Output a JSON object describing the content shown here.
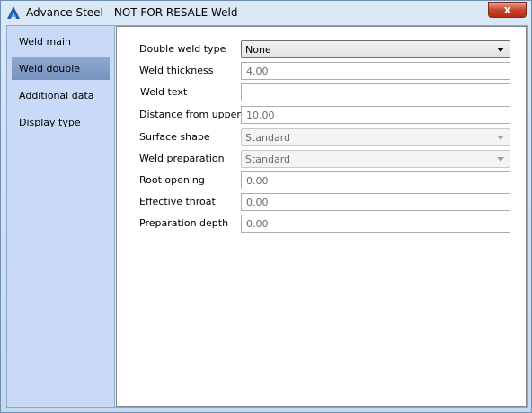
{
  "window": {
    "title": "Advance Steel - NOT FOR RESALE   Weld",
    "close_label": "x"
  },
  "sidebar": {
    "items": [
      {
        "label": "Weld main"
      },
      {
        "label": "Weld double"
      },
      {
        "label": "Additional data"
      },
      {
        "label": "Display type"
      }
    ],
    "active_index": 1
  },
  "form": {
    "double_weld_type": {
      "label": "Double weld type",
      "value": "None"
    },
    "weld_thickness": {
      "label": "Weld thickness",
      "value": "4.00"
    },
    "weld_text": {
      "label": "Weld text",
      "value": ""
    },
    "distance_from_upper": {
      "label": "Distance from upper",
      "value": "10.00"
    },
    "surface_shape": {
      "label": "Surface shape",
      "value": "Standard"
    },
    "weld_preparation": {
      "label": "Weld preparation",
      "value": "Standard"
    },
    "root_opening": {
      "label": "Root opening",
      "value": "0.00"
    },
    "effective_throat": {
      "label": "Effective throat",
      "value": "0.00"
    },
    "preparation_depth": {
      "label": "Preparation depth",
      "value": "0.00"
    }
  },
  "colors": {
    "sidebar_bg": "#c9daf8",
    "active_item": "#7f9ac4",
    "close_button": "#c7452b"
  }
}
